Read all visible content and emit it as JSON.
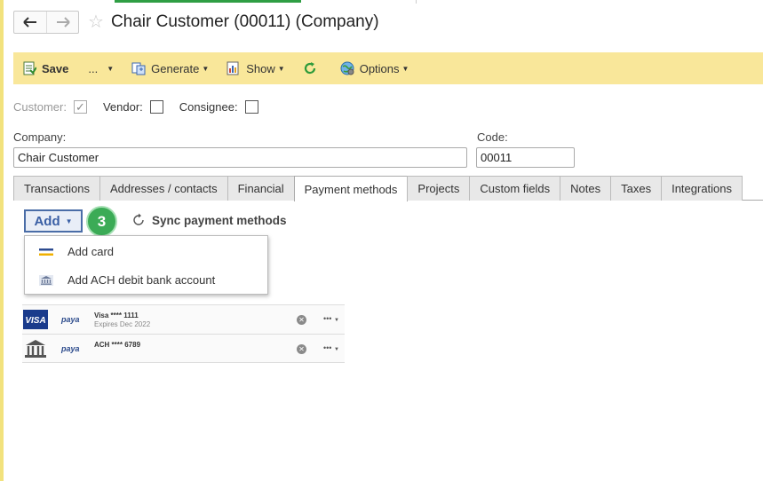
{
  "window": {
    "title": "Chair Customer (00011) (Company)"
  },
  "nav": {
    "back_icon": "arrow-left-icon",
    "forward_icon": "arrow-right-icon",
    "favorite_icon": "star-icon"
  },
  "toolbar": {
    "save_label": "Save",
    "more_label": "...",
    "generate_label": "Generate",
    "show_label": "Show",
    "options_label": "Options"
  },
  "flags": {
    "customer_label": "Customer:",
    "customer_checked": true,
    "vendor_label": "Vendor:",
    "vendor_checked": false,
    "consignee_label": "Consignee:",
    "consignee_checked": false
  },
  "form": {
    "company_label": "Company:",
    "company_value": "Chair Customer",
    "code_label": "Code:",
    "code_value": "00011"
  },
  "tabs": [
    {
      "label": "Transactions"
    },
    {
      "label": "Addresses / contacts"
    },
    {
      "label": "Financial"
    },
    {
      "label": "Payment methods",
      "active": true
    },
    {
      "label": "Projects"
    },
    {
      "label": "Custom fields"
    },
    {
      "label": "Notes"
    },
    {
      "label": "Taxes"
    },
    {
      "label": "Integrations"
    }
  ],
  "payment": {
    "add_label": "Add",
    "step_badge": "3",
    "sync_label": "Sync payment methods",
    "menu": [
      {
        "label": "Add card",
        "icon": "credit-card-icon"
      },
      {
        "label": "Add ACH debit bank account",
        "icon": "bank-icon"
      }
    ],
    "methods": [
      {
        "logo": "VISA",
        "processor": "paya",
        "name": "Visa **** 1111",
        "detail": "Expires Dec 2022",
        "more": "•••"
      },
      {
        "logo": "bank-icon",
        "processor": "paya",
        "name": "ACH **** 6789",
        "detail": "",
        "more": "•••"
      }
    ]
  },
  "colors": {
    "toolbar_bg": "#f9e79a",
    "accent_blue": "#3a5fa5",
    "badge_green": "#3bab56"
  }
}
